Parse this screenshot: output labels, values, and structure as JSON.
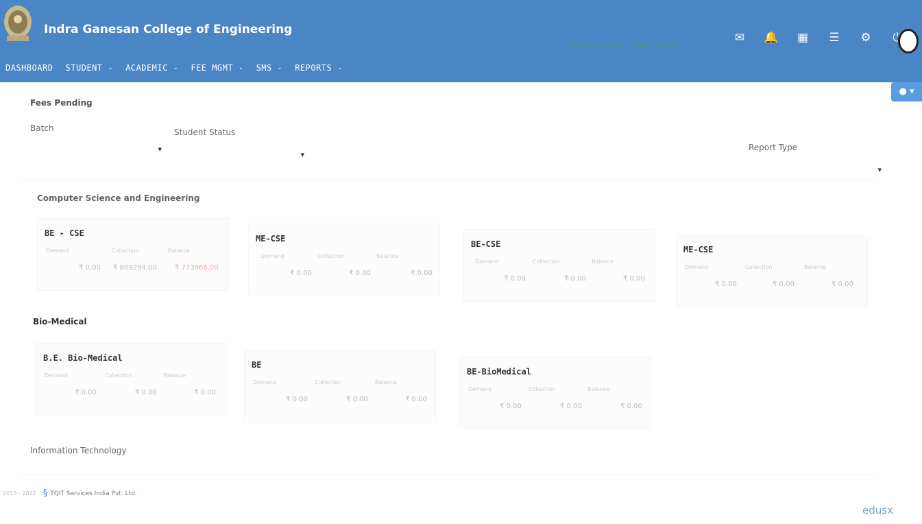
{
  "header": {
    "college_name": "Indra Ganesan College of Engineering",
    "admission_link": "Admission Portal",
    "enquiry_link": "Enquiry Portal",
    "nav": [
      "DASHBOARD",
      "STUDENT -",
      "ACADEMIC -",
      "FEE MGMT -",
      "SMS -",
      "REPORTS -"
    ],
    "icons": [
      "mail-icon",
      "notification-icon",
      "calendar-icon",
      "list-icon",
      "gear-icon",
      "power-icon"
    ]
  },
  "form": {
    "page_title": "Fees Pending",
    "batch_label": "Batch",
    "student_status_label": "Student Status",
    "report_type_label": "Report Type"
  },
  "sections": {
    "cse": {
      "title": "Computer Science and Engineering",
      "cards": [
        {
          "title": "BE - CSE",
          "demand_label": "Demand",
          "collection_label": "Collection",
          "balance_label": "Balance",
          "demand": "₹ 0.00",
          "collection": "₹ 809294.00",
          "balance": "₹ 773966.00"
        },
        {
          "title": "ME-CSE",
          "demand_label": "Demand",
          "collection_label": "Collection",
          "balance_label": "Balance",
          "demand": "₹ 0.00",
          "collection": "₹ 0.00",
          "balance": "₹ 0.00"
        },
        {
          "title": "BE-CSE",
          "demand_label": "Demand",
          "collection_label": "Collection",
          "balance_label": "Balance",
          "demand": "₹ 0.00",
          "collection": "₹ 0.00",
          "balance": "₹ 0.00"
        },
        {
          "title": "ME-CSE",
          "demand_label": "Demand",
          "collection_label": "Collection",
          "balance_label": "Balance",
          "demand": "₹ 0.00",
          "collection": "₹ 0.00",
          "balance": "₹ 0.00"
        }
      ]
    },
    "biomedical": {
      "title": "Bio-Medical",
      "cards": [
        {
          "title": "B.E. Bio-Medical",
          "demand_label": "Demand",
          "collection_label": "Collection",
          "balance_label": "Balance",
          "demand": "₹ 0.00",
          "collection": "₹ 0.00",
          "balance": "₹ 0.00"
        },
        {
          "title": "BE",
          "demand_label": "Demand",
          "collection_label": "Collection",
          "balance_label": "Balance",
          "demand": "₹ 0.00",
          "collection": "₹ 0.00",
          "balance": "₹ 0.00"
        },
        {
          "title": "BE-BioMedical",
          "demand_label": "Demand",
          "collection_label": "Collection",
          "balance_label": "Balance",
          "demand": "₹ 0.00",
          "collection": "₹ 0.00",
          "balance": "₹ 0.00"
        }
      ]
    },
    "it": {
      "title": "Information Technology"
    }
  },
  "footer": {
    "copyright": "2015 - 2022",
    "company": "TQIT Services India Pvt. Ltd.",
    "brand": "edusx"
  }
}
